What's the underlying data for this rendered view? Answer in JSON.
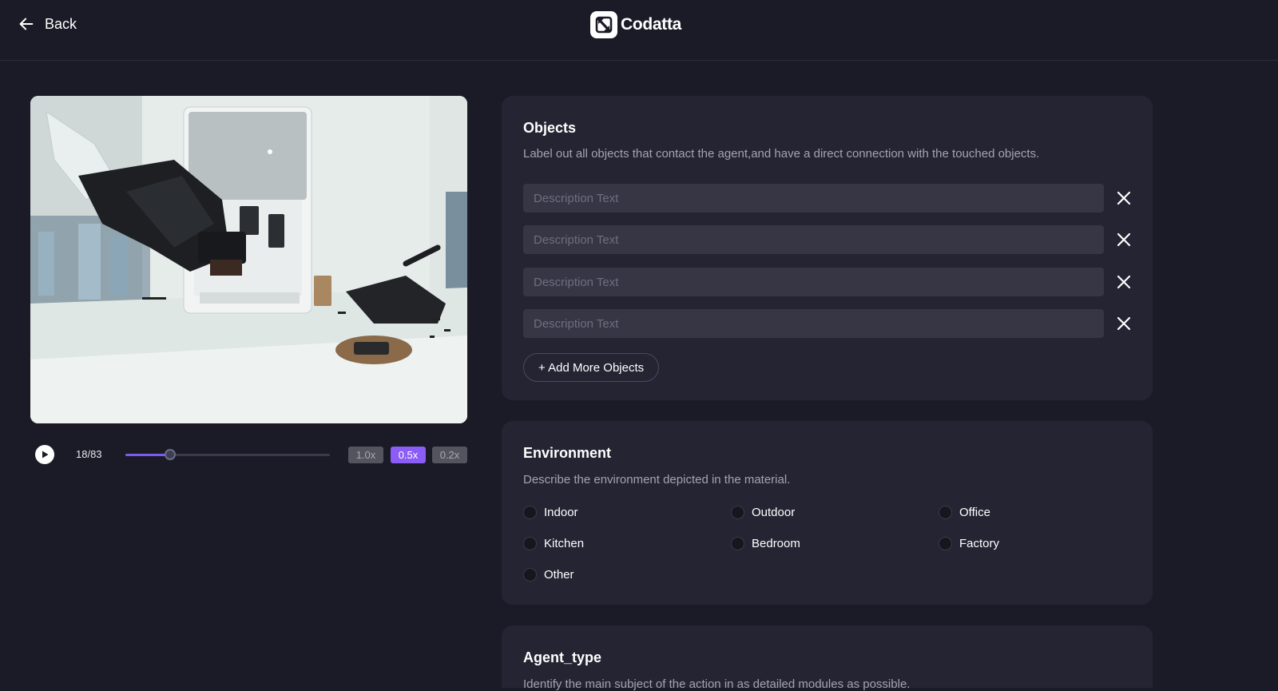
{
  "header": {
    "back_label": "Back",
    "brand_name": "Codatta"
  },
  "player": {
    "frame_counter": "18/83",
    "progress_fraction": 0.217,
    "speeds": [
      {
        "label": "1.0x",
        "active": false
      },
      {
        "label": "0.5x",
        "active": true
      },
      {
        "label": "0.2x",
        "active": false
      }
    ]
  },
  "objects": {
    "title": "Objects",
    "description": "Label out all objects that contact the agent,and have a direct connection with the touched objects.",
    "inputs": [
      {
        "placeholder": "Description Text",
        "value": ""
      },
      {
        "placeholder": "Description Text",
        "value": ""
      },
      {
        "placeholder": "Description Text",
        "value": ""
      },
      {
        "placeholder": "Description Text",
        "value": ""
      }
    ],
    "add_label": "+ Add More Objects"
  },
  "environment": {
    "title": "Environment",
    "description": "Describe the environment depicted in the material.",
    "options": [
      "Indoor",
      "Outdoor",
      "Office",
      "Kitchen",
      "Bedroom",
      "Factory",
      "Other"
    ]
  },
  "agent_type": {
    "title": "Agent_type",
    "description": "Identify the main subject of the action in as detailed modules as possible."
  },
  "colors": {
    "background": "#1b1b28",
    "card": "#242433",
    "accent": "#8b5cf6",
    "input": "#363645"
  }
}
